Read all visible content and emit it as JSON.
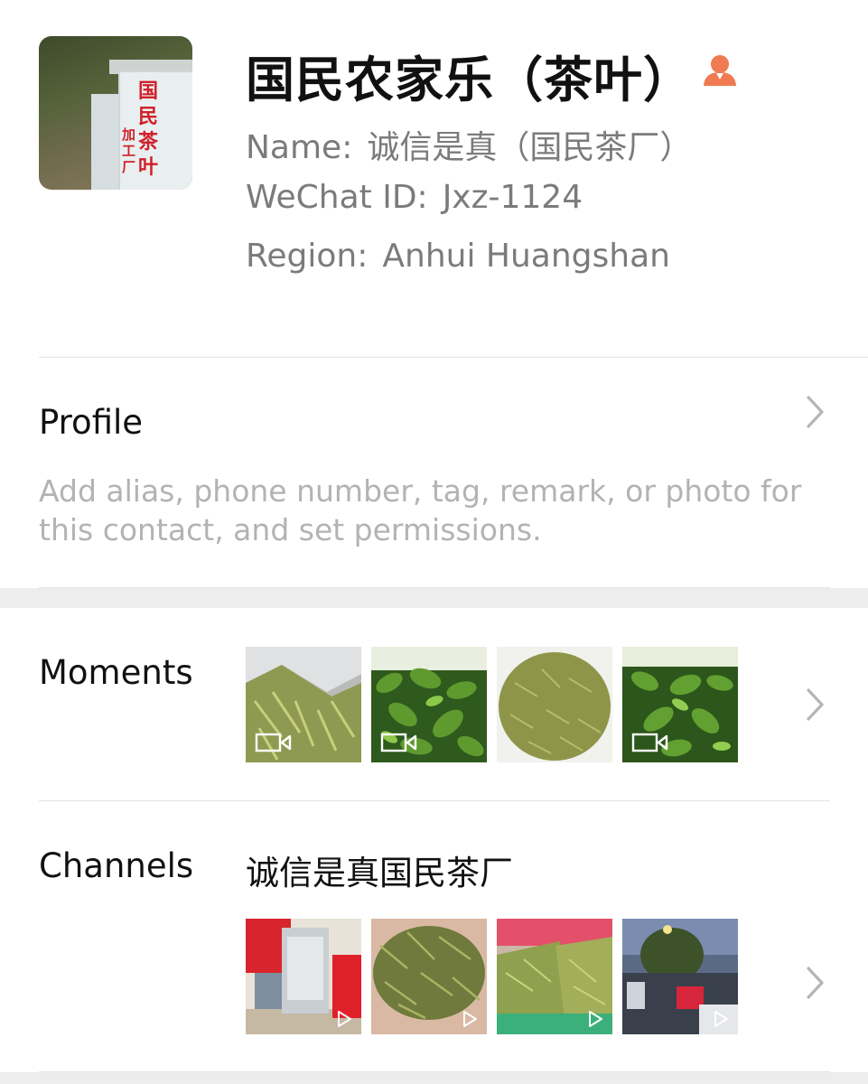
{
  "contact": {
    "display_name": "国民农家乐（茶叶）",
    "name_label": "Name:",
    "name_value": "诚信是真（国民茶厂）",
    "wechat_label": "WeChat ID:",
    "wechat_value": "Jxz-1124",
    "region_label": "Region:",
    "region_value": "Anhui  Huangshan",
    "avatar_sign_text": "国民茶叶",
    "avatar_sign_sub": "加工厂"
  },
  "profile": {
    "label": "Profile",
    "description": "Add alias, phone number, tag, remark, or photo for this contact, and set permissions."
  },
  "moments": {
    "label": "Moments",
    "thumbs": [
      {
        "kind": "video",
        "scene": "dried-tea-bag"
      },
      {
        "kind": "video",
        "scene": "tea-bush"
      },
      {
        "kind": "photo",
        "scene": "dried-tea-pile"
      },
      {
        "kind": "video",
        "scene": "tea-bush"
      }
    ]
  },
  "channels": {
    "label": "Channels",
    "channel_name": "诚信是真国民茶厂",
    "thumbs": [
      {
        "kind": "video",
        "scene": "tea-bags-table"
      },
      {
        "kind": "video",
        "scene": "dried-tea-hand"
      },
      {
        "kind": "video",
        "scene": "tea-boxes"
      },
      {
        "kind": "video",
        "scene": "street-night"
      }
    ]
  },
  "colors": {
    "primary_text": "#111111",
    "secondary_text": "#7b7b7b",
    "hint_text": "#b3b3b3",
    "divider": "#e4e4e4",
    "band": "#ededed",
    "person_icon": "#f07a52",
    "chevron": "#b5b5b5"
  },
  "icons": {
    "gender_icon": "person-icon",
    "chevron": "chevron-right-icon",
    "video_badge": "video-camera-icon",
    "play_badge": "play-icon"
  }
}
